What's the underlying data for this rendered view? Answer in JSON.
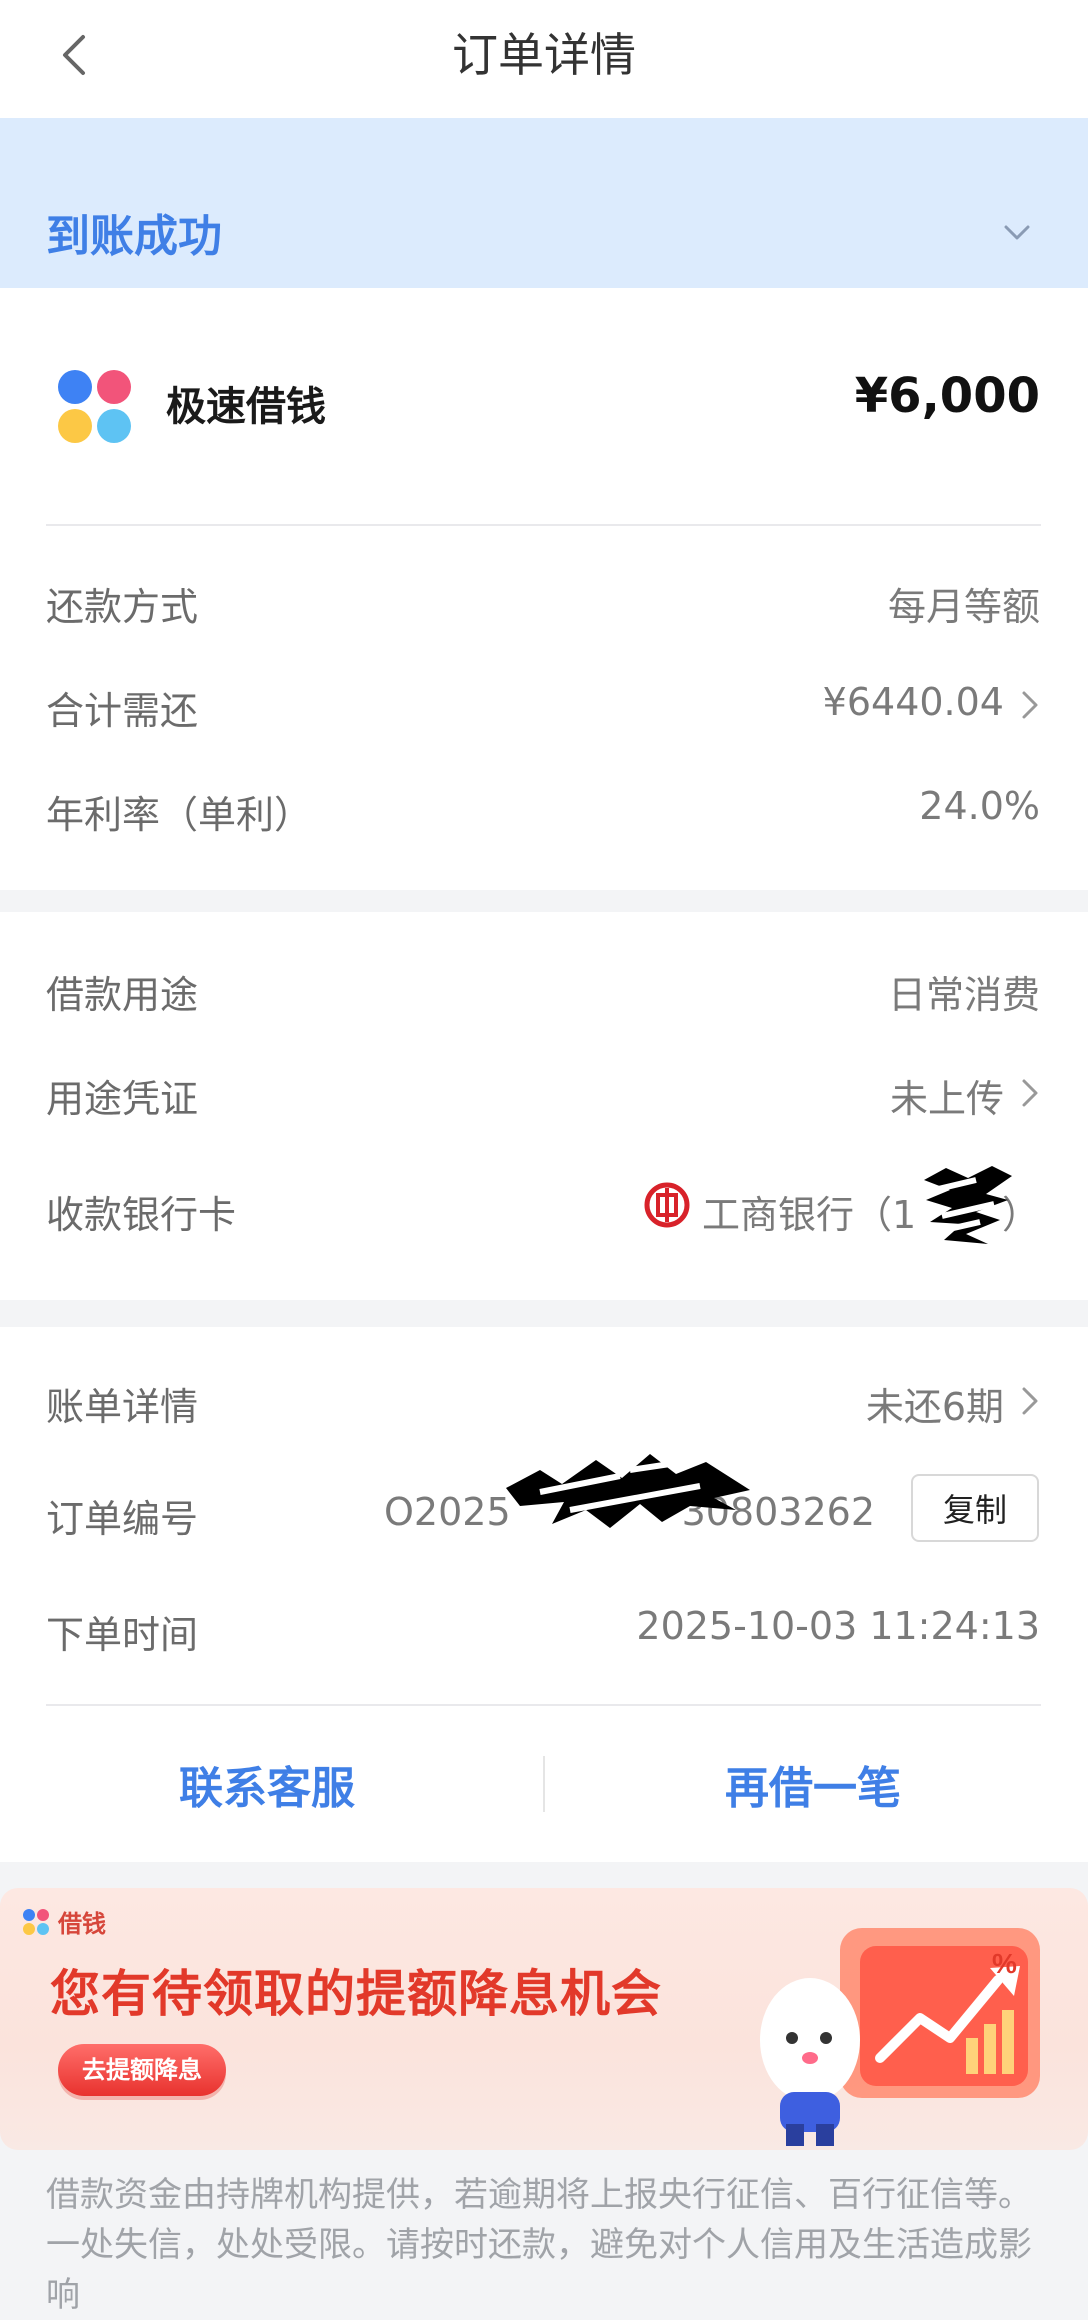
{
  "header": {
    "title": "订单详情",
    "back_icon": "chevron-left-icon"
  },
  "status": {
    "text": "到账成功",
    "expand_icon": "chevron-down-icon",
    "band_color": "#dcebfd",
    "text_color": "#3f7fe6"
  },
  "product": {
    "name": "极速借钱",
    "amount": "¥6,000"
  },
  "loan_terms": [
    {
      "label": "还款方式",
      "value": "每月等额"
    },
    {
      "label": "合计需还",
      "value": "¥6440.04"
    },
    {
      "label": "年利率（单利）",
      "value": "24.0%"
    }
  ],
  "loan_info": {
    "purpose": {
      "label": "借款用途",
      "value": "日常消费"
    },
    "proof": {
      "label": "用途凭证",
      "value": "未上传"
    },
    "bank": {
      "label": "收款银行卡",
      "value": "工商银行（1",
      "value_tail": "）"
    }
  },
  "order_info": {
    "bill": {
      "label": "账单详情",
      "value": "未还6期"
    },
    "order_no": {
      "label": "订单编号",
      "value_prefix": "O2025",
      "value_suffix": "30803262",
      "copy_label": "复制"
    },
    "order_time": {
      "label": "下单时间",
      "value": "2025-10-03 11:24:13"
    }
  },
  "actions": {
    "contact": "联系客服",
    "borrow_again": "再借一笔"
  },
  "banner": {
    "brand": "借钱",
    "title": "您有待领取的提额降息机会",
    "button": "去提额降息",
    "percent_symbol": "%"
  },
  "disclaimer": "借款资金由持牌机构提供，若逾期将上报央行征信、百行征信等。一处失信，处处受限。请按时还款，避免对个人信用及生活造成影响"
}
